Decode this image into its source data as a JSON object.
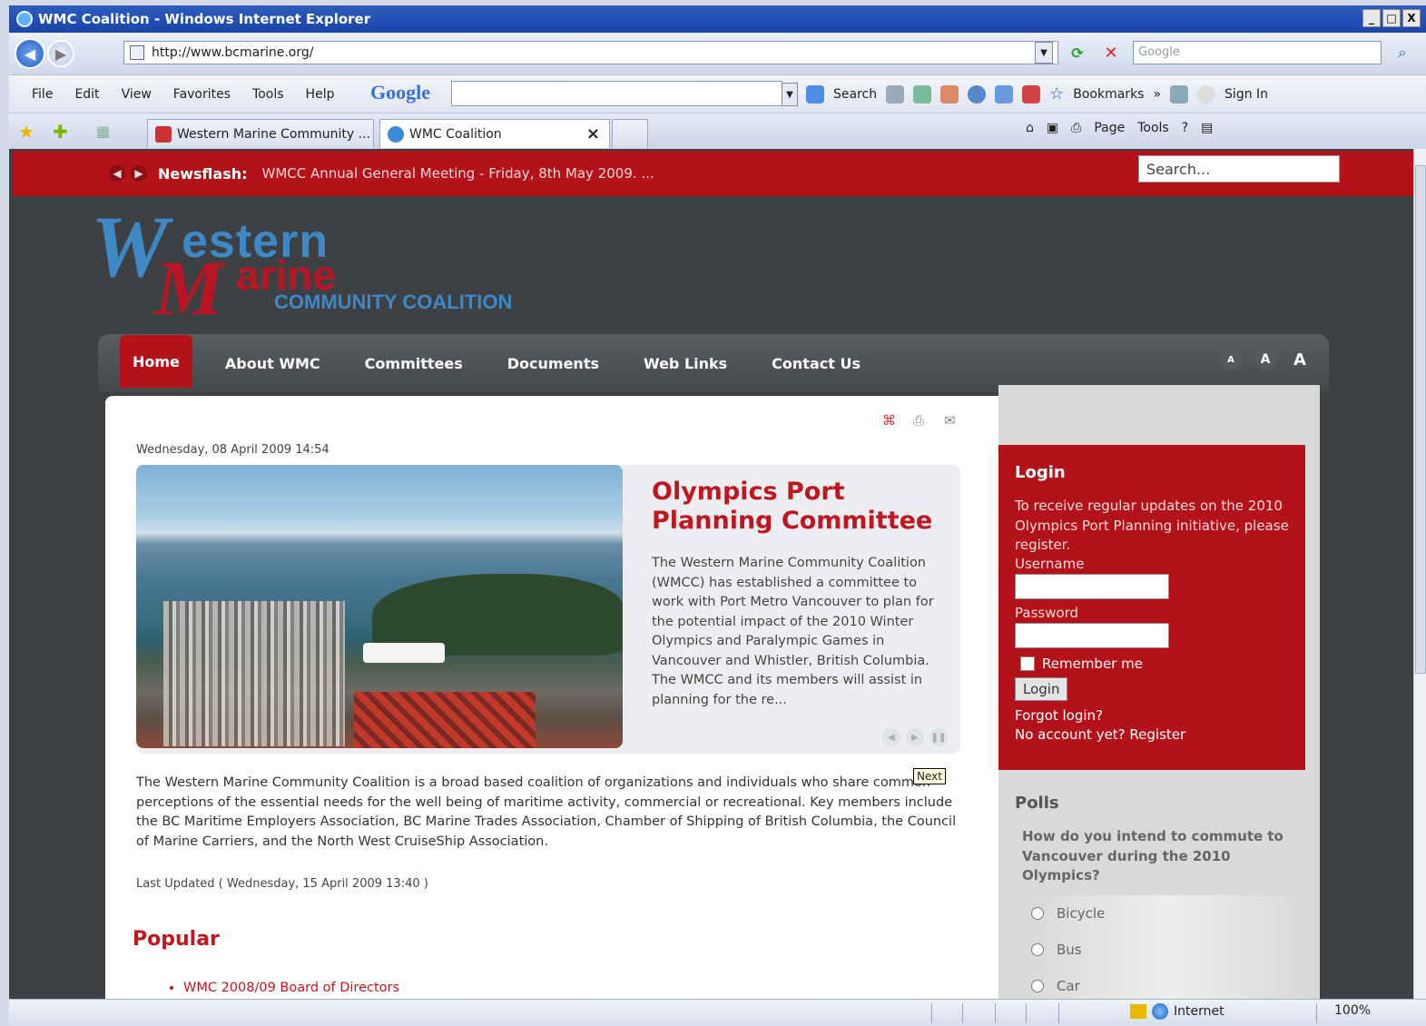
{
  "window": {
    "title": "WMC Coalition - Windows Internet Explorer",
    "controls": [
      "_",
      "□",
      "X"
    ]
  },
  "address": {
    "url": "http://www.bcmarine.org/",
    "search_placeholder": "Google"
  },
  "menu": {
    "items": [
      "File",
      "Edit",
      "View",
      "Favorites",
      "Tools",
      "Help"
    ],
    "google_logo": "Google",
    "toolbar": [
      "Search",
      "Bookmarks",
      "Sign In"
    ]
  },
  "tabs": {
    "items": [
      {
        "label": "Western Marine Community ..."
      },
      {
        "label": "WMC Coalition"
      }
    ],
    "close": "×",
    "commands": [
      "Page",
      "Tools"
    ]
  },
  "site": {
    "newsflash_label": "Newsflash:",
    "newsflash_text": "WMCC Annual General Meeting - Friday, 8th May 2009. ...",
    "search_placeholder": "Search...",
    "logo": {
      "w": "W",
      "estern": "estern",
      "m": "M",
      "arine": "arine",
      "tagline": "COMMUNITY COALITION"
    },
    "nav": [
      "Home",
      "About WMC",
      "Committees",
      "Documents",
      "Web Links",
      "Contact Us"
    ],
    "font_sizes": [
      "A",
      "A",
      "A"
    ],
    "date": "Wednesday, 08 April 2009 14:54",
    "slide": {
      "title": "Olympics Port Planning Committee",
      "text": "The Western Marine Community Coalition (WMCC) has established a committee to work with Port Metro Vancouver to plan for the potential impact of the 2010 Winter Olympics and Paralympic Games in Vancouver and Whistler, British Columbia.  The WMCC and its members will assist in planning for the re..."
    },
    "tooltip": "Next",
    "intro": "The Western Marine Community Coalition is a broad based coalition of organizations and individuals who share common perceptions of the essential needs for the well being of maritime activity, commercial or recreational.  Key members include the BC Maritime Employers Association, BC Marine Trades Association, Chamber of Shipping of British Columbia, the Council of Marine Carriers, and the North West CruiseShip Association.",
    "last_updated": "Last Updated ( Wednesday, 15 April 2009 13:40 )",
    "popular_title": "Popular",
    "popular_items": [
      "WMC 2008/09 Board of Directors"
    ],
    "login": {
      "title": "Login",
      "text": "To receive regular updates on the 2010 Olympics Port Planning initiative, please register.",
      "username_label": "Username",
      "password_label": "Password",
      "remember": "Remember me",
      "button": "Login",
      "forgot": "Forgot login?",
      "register": "No account yet? Register"
    },
    "polls": {
      "title": "Polls",
      "question": "How do you intend to commute to Vancouver during the 2010 Olympics?",
      "options": [
        "Bicycle",
        "Bus",
        "Car"
      ]
    }
  },
  "status": {
    "zone": "Internet",
    "zoom": "100%"
  }
}
